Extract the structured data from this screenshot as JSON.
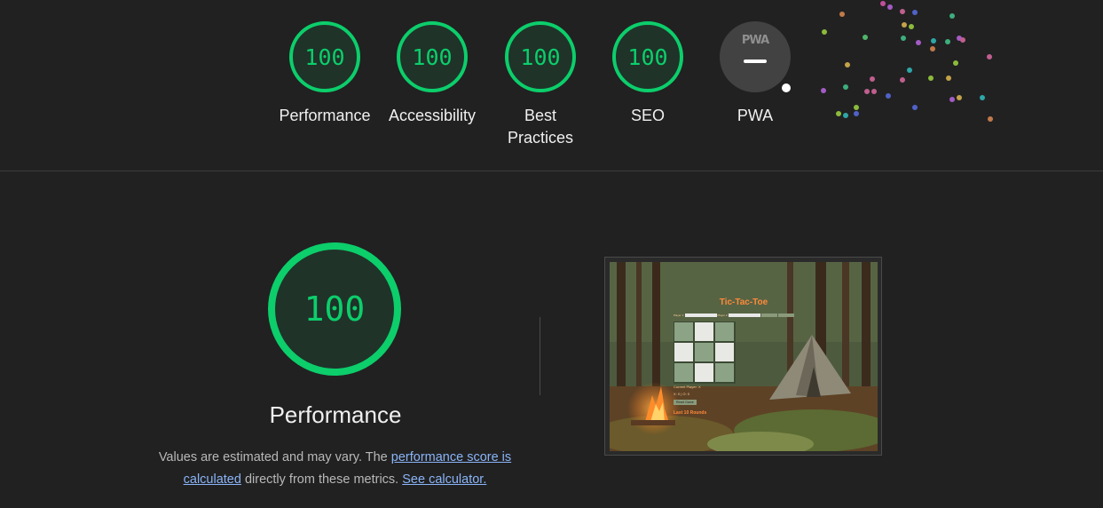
{
  "gauges": [
    {
      "score": "100",
      "label": "Performance",
      "icon": "score-gauge"
    },
    {
      "score": "100",
      "label": "Accessibility",
      "icon": "score-gauge"
    },
    {
      "score": "100",
      "label": "Best Practices",
      "icon": "score-gauge"
    },
    {
      "score": "100",
      "label": "SEO",
      "icon": "score-gauge"
    }
  ],
  "pwa": {
    "logo_text": "PWA",
    "label": "PWA",
    "icon": "pwa-icon"
  },
  "colors": {
    "pass": "#0cce6b",
    "background": "#212121",
    "link": "#8ab4f8"
  },
  "performance": {
    "score": "100",
    "title": "Performance",
    "desc_prefix": "Values are estimated and may vary. The ",
    "link_score": "performance score is calculated",
    "desc_middle": " directly from these metrics. ",
    "link_calculator": "See calculator."
  },
  "screenshot": {
    "title": "Tic-Tac-Toe",
    "player1_label": "Player 1:",
    "player2_label": "Player 2:",
    "current_player": "Current Player: X",
    "score": "X: 0 | O: 0",
    "reset_button": "Reset Game",
    "rounds": "Last 10 Rounds"
  }
}
